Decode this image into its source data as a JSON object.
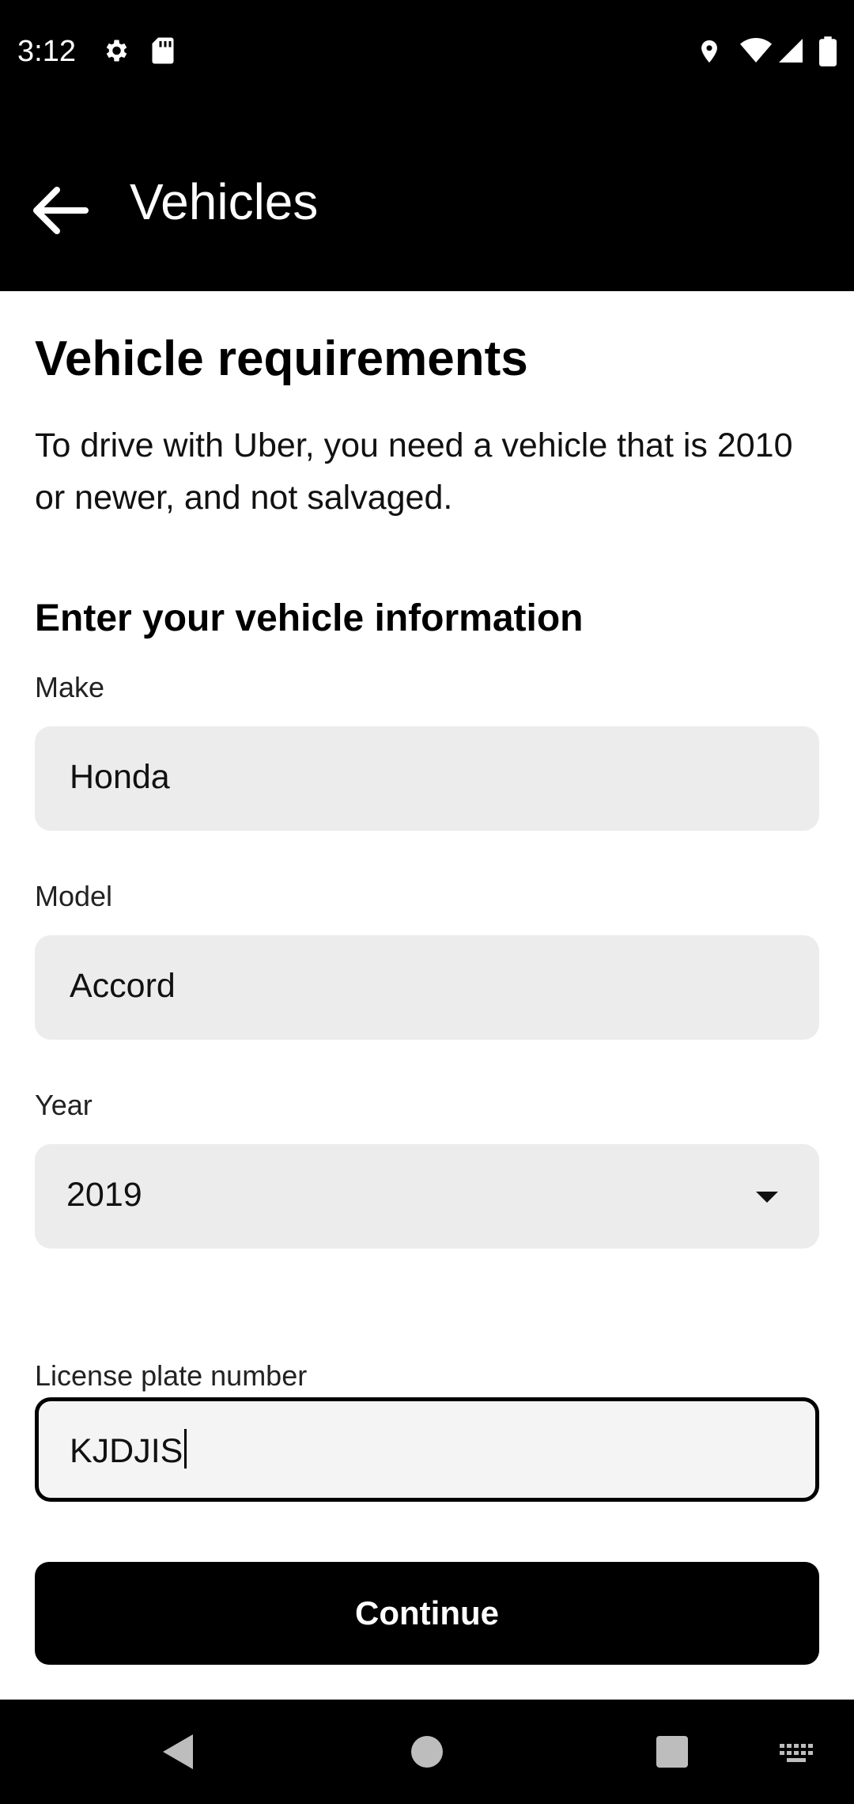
{
  "status": {
    "time": "3:12",
    "icons": [
      "gear-icon",
      "sd-card-icon",
      "location-icon",
      "wifi-icon",
      "signal-icon",
      "battery-icon"
    ]
  },
  "appbar": {
    "title": "Vehicles",
    "back_icon": "arrow-left-icon"
  },
  "main": {
    "heading": "Vehicle requirements",
    "description": "To drive with Uber, you need a vehicle that is 2010 or newer, and not salvaged.",
    "subheading": "Enter your vehicle information",
    "make": {
      "label": "Make",
      "value": "Honda"
    },
    "model": {
      "label": "Model",
      "value": "Accord"
    },
    "year": {
      "label": "Year",
      "value": "2019"
    },
    "plate": {
      "label": "License plate number",
      "value": "KJDJIS"
    }
  },
  "footer": {
    "continue_label": "Continue"
  },
  "navbar": {
    "icons": [
      "nav-back-icon",
      "nav-home-icon",
      "nav-recents-icon",
      "keyboard-icon"
    ]
  },
  "colors": {
    "topbar": "#000000",
    "field_bg": "#ececec",
    "button_bg": "#000000"
  }
}
